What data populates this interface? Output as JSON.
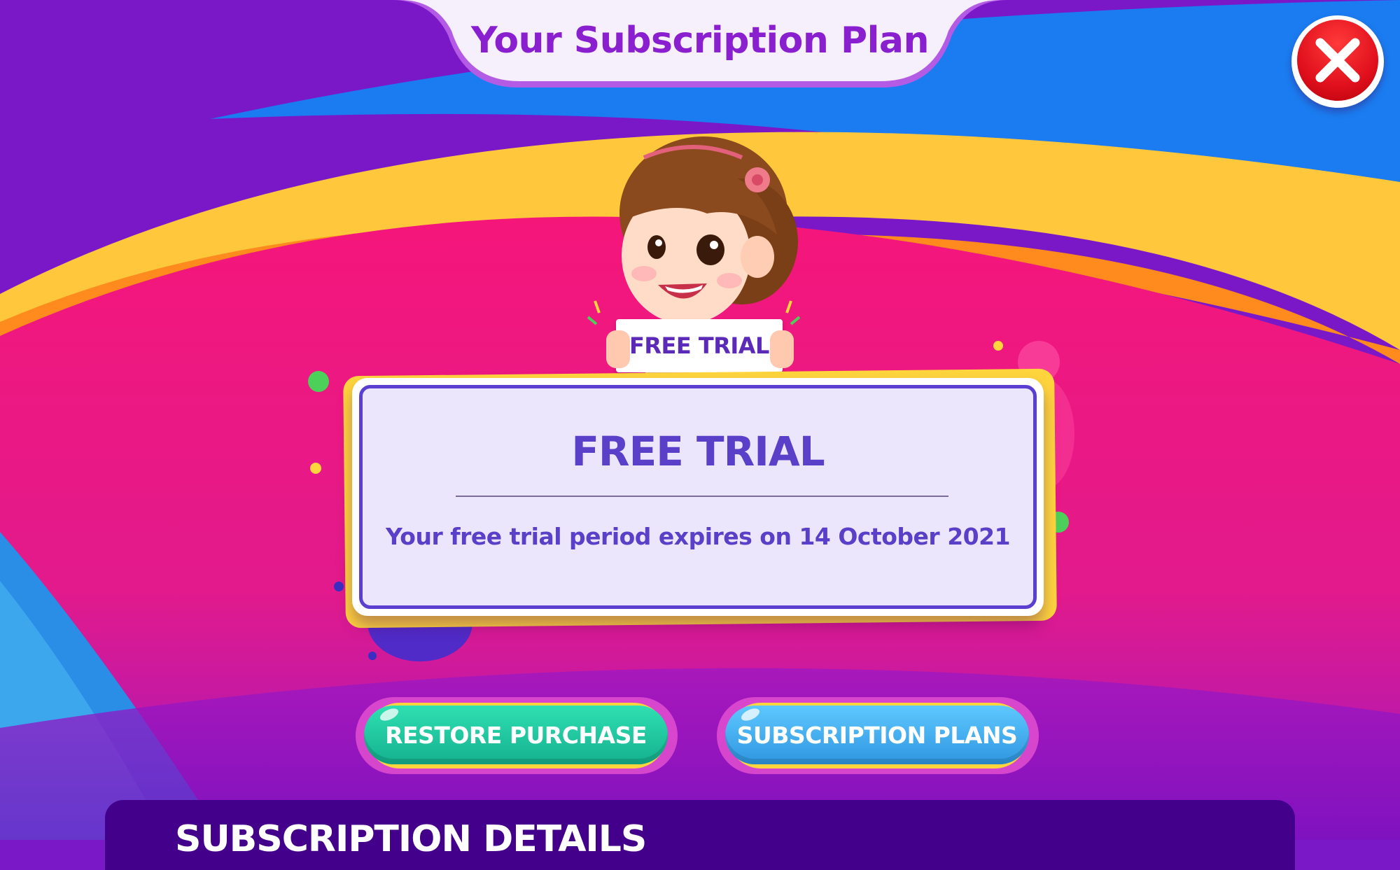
{
  "header": {
    "title": "Your Subscription Plan"
  },
  "close_button": {
    "icon": "close-icon",
    "color": "#e0101c"
  },
  "character": {
    "sign_text": "FREE TRIAL"
  },
  "plan_card": {
    "title": "FREE TRIAL",
    "message": "Your free trial period expires on 14 October 2021"
  },
  "buttons": {
    "restore": {
      "label": "RESTORE PURCHASE",
      "color": "#14b08e"
    },
    "plans": {
      "label": "SUBSCRIPTION PLANS",
      "color": "#2f96e0"
    }
  },
  "details_panel": {
    "title": "SUBSCRIPTION DETAILS"
  },
  "colors": {
    "purple": "#7a18c8",
    "pink": "#f0187a",
    "yellow": "#ffc83c",
    "blue": "#1a7cf0",
    "card_text": "#5a3fc8"
  }
}
